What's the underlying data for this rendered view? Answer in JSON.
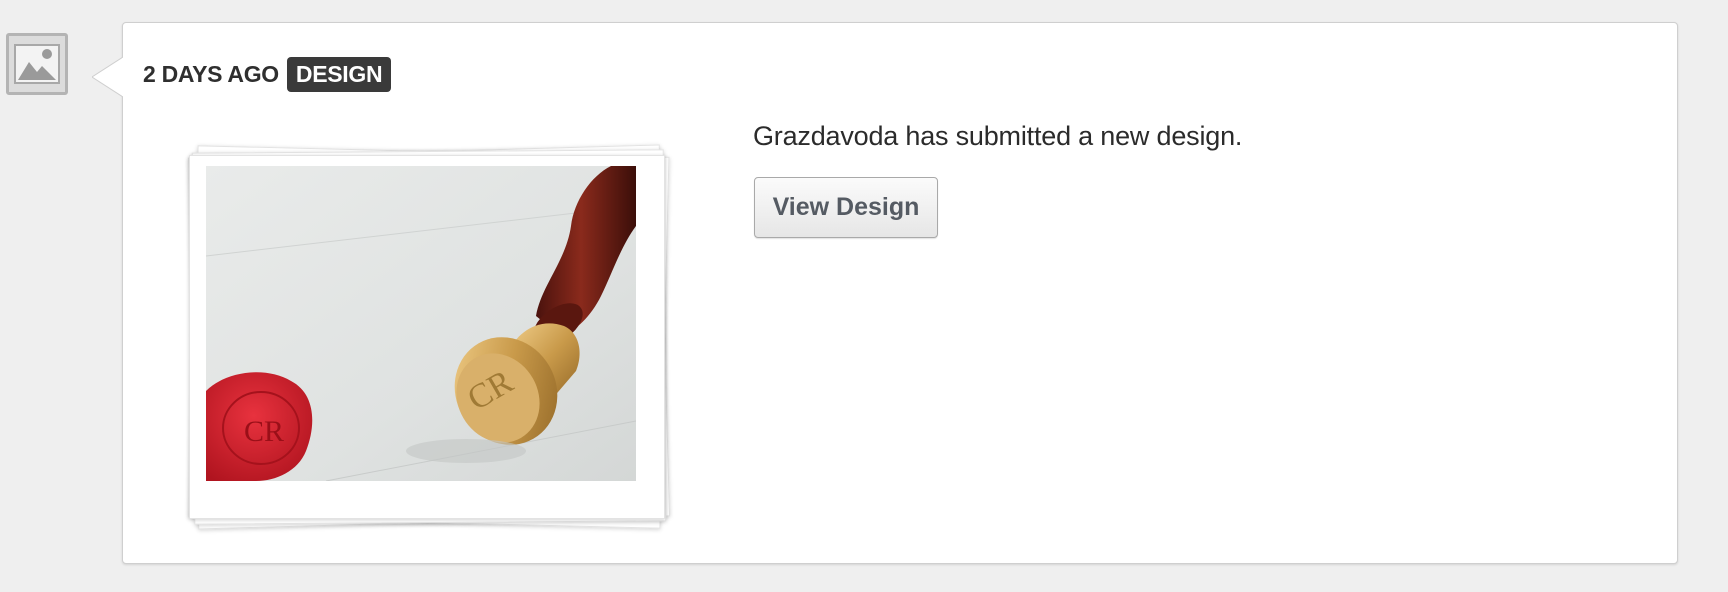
{
  "feed_item": {
    "type_icon": "image-icon",
    "time_label": "2 DAYS AGO",
    "category": "DESIGN",
    "message": "Grazdavoda has submitted a new design.",
    "view_button_label": "View Design",
    "thumbnail": {
      "subject": "wax-seal-stamp-photo"
    }
  },
  "colors": {
    "page_background": "#efefef",
    "card_background": "#ffffff",
    "badge_background": "#3a3a3a",
    "wax_red": "#d3222e",
    "handle_brown": "#6b1d14",
    "brass": "#c99a4a"
  }
}
